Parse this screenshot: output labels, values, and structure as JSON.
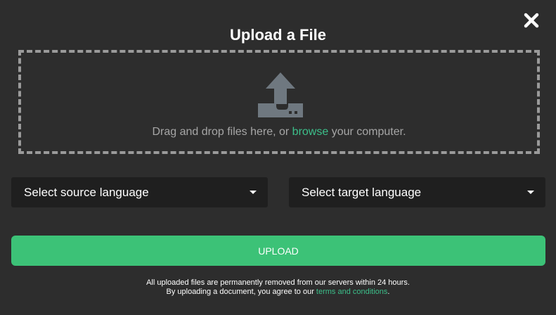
{
  "dialog": {
    "title": "Upload a File",
    "close_icon": "close-icon"
  },
  "dropzone": {
    "icon": "upload-icon",
    "text_before": "Drag and drop files here, or ",
    "browse_label": "browse",
    "text_after": " your computer."
  },
  "source_select": {
    "label": "Select source language",
    "caret_icon": "caret-down-icon"
  },
  "target_select": {
    "label": "Select target language",
    "caret_icon": "caret-down-icon"
  },
  "upload_button": {
    "label": "UPLOAD"
  },
  "notice": {
    "line1": "All uploaded files are permanently removed from our servers within 24 hours.",
    "line2_before": "By uploading a document, you agree to our ",
    "terms_label": "terms and conditions",
    "line2_after": "."
  },
  "colors": {
    "background": "#2d2d2d",
    "accent_link": "#3cbf8a",
    "upload_button": "#3cc277",
    "select_background": "#1f1f1f",
    "dashed_border": "#9a9a9a",
    "icon_gray": "#6f7880"
  }
}
